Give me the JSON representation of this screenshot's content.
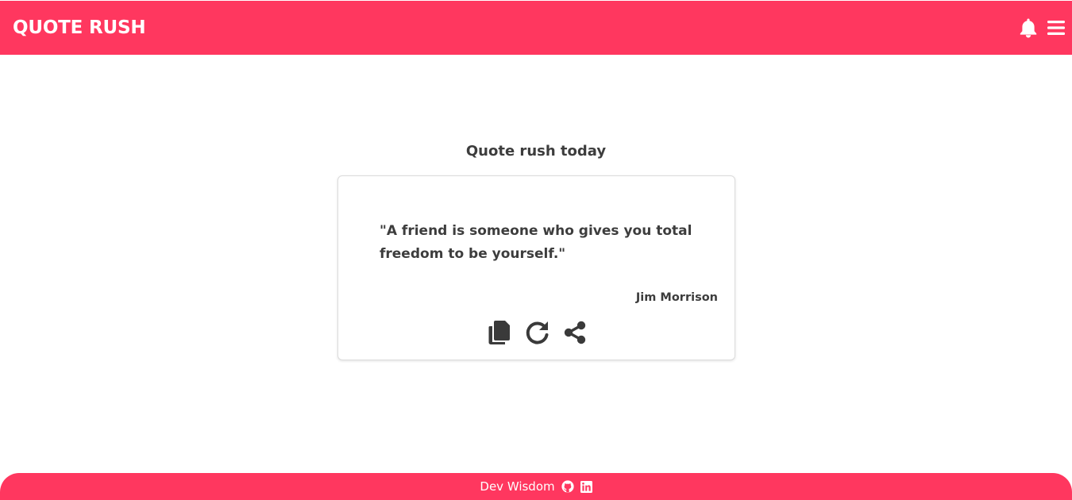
{
  "header": {
    "title": "QUOTE RUSH",
    "background_color": "#ff375f",
    "icons": [
      "bell-icon",
      "menu-icon"
    ]
  },
  "main": {
    "heading": "Quote rush today",
    "quote": {
      "text": "\"A friend is someone who gives you total freedom to be yourself.\"",
      "author": "Jim Morrison"
    },
    "actions": [
      "copy-icon",
      "refresh-icon",
      "share-icon"
    ]
  },
  "footer": {
    "text": "Dev Wisdom",
    "icons": [
      "github-icon",
      "linkedin-icon"
    ]
  },
  "colors": {
    "accent": "#ff375f",
    "text": "#3d3d3d"
  }
}
